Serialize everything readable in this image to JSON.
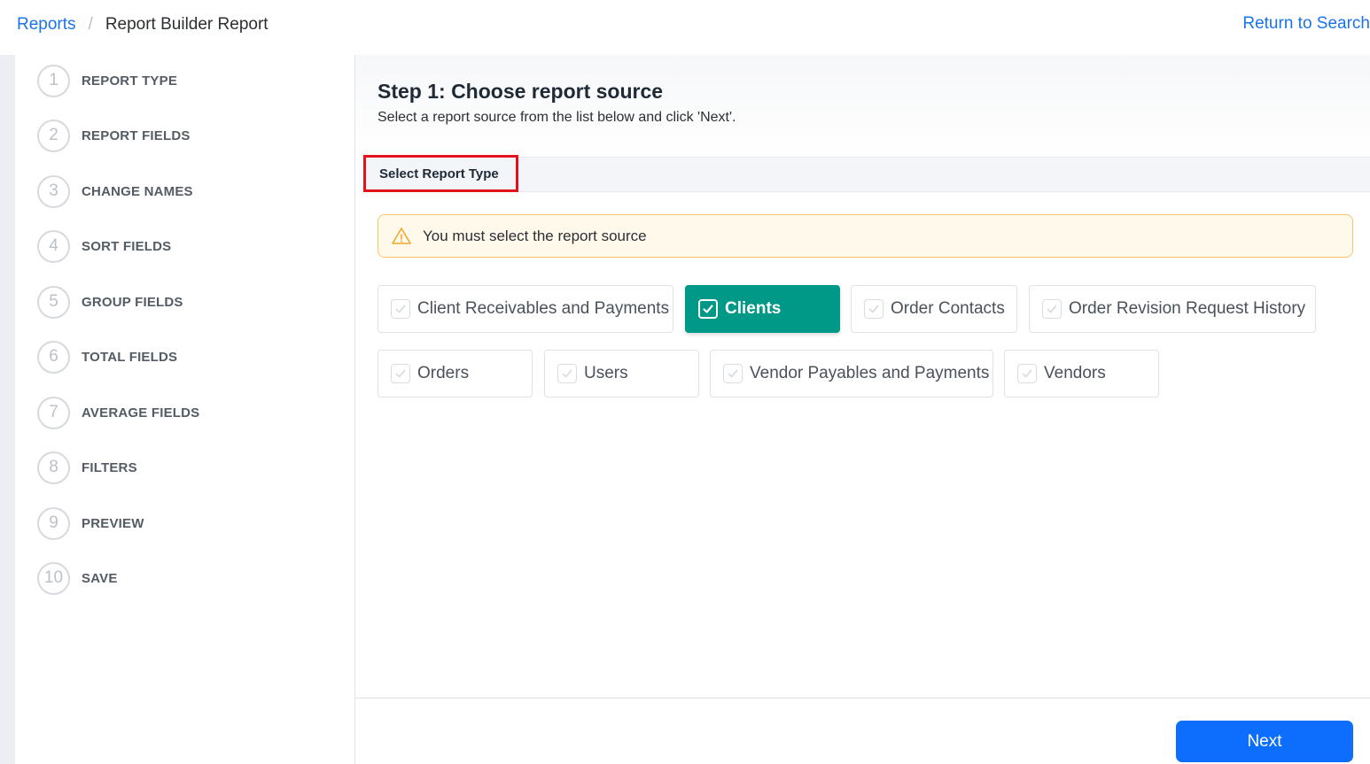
{
  "breadcrumb": {
    "root": "Reports",
    "separator": "/",
    "current": "Report Builder Report"
  },
  "header": {
    "return_link": "Return to Search"
  },
  "steps": [
    {
      "number": "1",
      "label": "REPORT TYPE"
    },
    {
      "number": "2",
      "label": "REPORT FIELDS"
    },
    {
      "number": "3",
      "label": "CHANGE NAMES"
    },
    {
      "number": "4",
      "label": "SORT FIELDS"
    },
    {
      "number": "5",
      "label": "GROUP FIELDS"
    },
    {
      "number": "6",
      "label": "TOTAL FIELDS"
    },
    {
      "number": "7",
      "label": "AVERAGE FIELDS"
    },
    {
      "number": "8",
      "label": "FILTERS"
    },
    {
      "number": "9",
      "label": "PREVIEW"
    },
    {
      "number": "10",
      "label": "SAVE"
    }
  ],
  "main": {
    "title": "Step 1: Choose report source",
    "subtitle": "Select a report source from the list below and click 'Next'.",
    "section_label": "Select Report Type",
    "alert_text": "You must select the report source",
    "alert_icon": "warning-triangle-icon",
    "options": [
      {
        "label": "Client Receivables and Payments",
        "selected": false
      },
      {
        "label": "Clients",
        "selected": true
      },
      {
        "label": "Order Contacts",
        "selected": false
      },
      {
        "label": "Order Revision Request History",
        "selected": false
      },
      {
        "label": "Orders",
        "selected": false
      },
      {
        "label": "Users",
        "selected": false
      },
      {
        "label": "Vendor Payables and Payments",
        "selected": false
      },
      {
        "label": "Vendors",
        "selected": false
      }
    ],
    "next_label": "Next"
  },
  "colors": {
    "link": "#1a73e8",
    "selected_option": "#009987",
    "primary_button": "#0d6efd",
    "highlight_border": "#e3121b",
    "alert_bg": "#fff9ec"
  }
}
